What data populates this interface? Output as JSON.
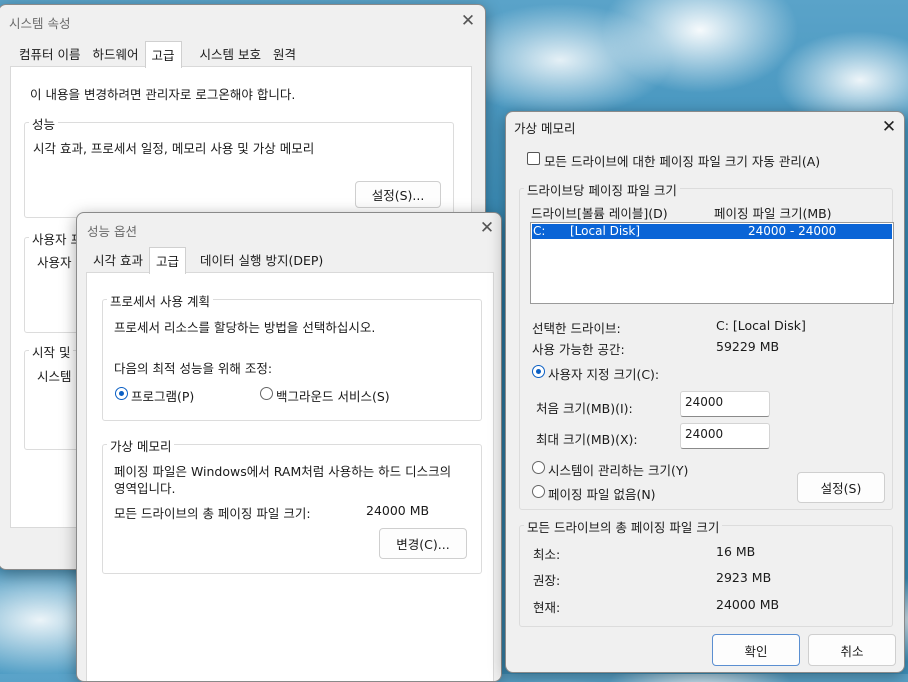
{
  "system_properties": {
    "title": "시스템 속성",
    "tabs": [
      "컴퓨터 이름",
      "하드웨어",
      "고급",
      "시스템 보호",
      "원격"
    ],
    "admin_notice": "이 내용을 변경하려면 관리자로 로그온해야 합니다.",
    "performance": {
      "label": "성능",
      "description": "시각 효과, 프로세서 일정, 메모리 사용 및 가상 메모리",
      "settings_button": "설정(S)..."
    },
    "user_profile": {
      "label": "사용자 프",
      "text": "사용자"
    },
    "startup_recovery": {
      "label": "시작 및",
      "text": "시스템"
    }
  },
  "performance_options": {
    "title": "성능 옵션",
    "tabs": [
      "시각 효과",
      "고급",
      "데이터 실행 방지(DEP)"
    ],
    "processor": {
      "label": "프로세서 사용 계획",
      "description": "프로세서 리소스를 할당하는 방법을 선택하십시오.",
      "adjust_label": "다음의 최적 성능을 위해 조정:",
      "option_programs": "프로그램(P)",
      "option_background": "백그라운드 서비스(S)"
    },
    "virtual_memory": {
      "label": "가상 메모리",
      "description_line1": "페이징 파일은 Windows에서 RAM처럼 사용하는 하드 디스크의",
      "description_line2": "영역입니다.",
      "total_label": "모든 드라이브의 총 페이징 파일 크기:",
      "total_value": "24000 MB",
      "change_button": "변경(C)..."
    }
  },
  "virtual_memory_dialog": {
    "title": "가상 메모리",
    "auto_manage_label": "모든 드라이브에 대한 페이징 파일 크기 자동 관리(A)",
    "auto_manage_checked": false,
    "per_drive": {
      "label": "드라이브당 페이징 파일 크기",
      "col_drive": "드라이브[볼륨 레이블](D)",
      "col_size": "페이징 파일 크기(MB)",
      "rows": [
        {
          "drive": "C:",
          "volume": "[Local Disk]",
          "size": "24000 - 24000",
          "selected": true
        }
      ],
      "selected_drive_label": "선택한 드라이브:",
      "selected_drive_value": "C:  [Local Disk]",
      "available_label": "사용 가능한 공간:",
      "available_value": "59229 MB",
      "custom_size_label": "사용자 지정 크기(C):",
      "initial_label": "처음 크기(MB)(I):",
      "initial_value": "24000",
      "max_label": "최대 크기(MB)(X):",
      "max_value": "24000",
      "system_managed_label": "시스템이 관리하는 크기(Y)",
      "no_paging_label": "페이징 파일 없음(N)",
      "set_button": "설정(S)"
    },
    "totals": {
      "label": "모든 드라이브의 총 페이징 파일 크기",
      "min_label": "최소:",
      "min_value": "16 MB",
      "recommended_label": "권장:",
      "recommended_value": "2923 MB",
      "current_label": "현재:",
      "current_value": "24000 MB"
    },
    "ok_button": "확인",
    "cancel_button": "취소"
  }
}
